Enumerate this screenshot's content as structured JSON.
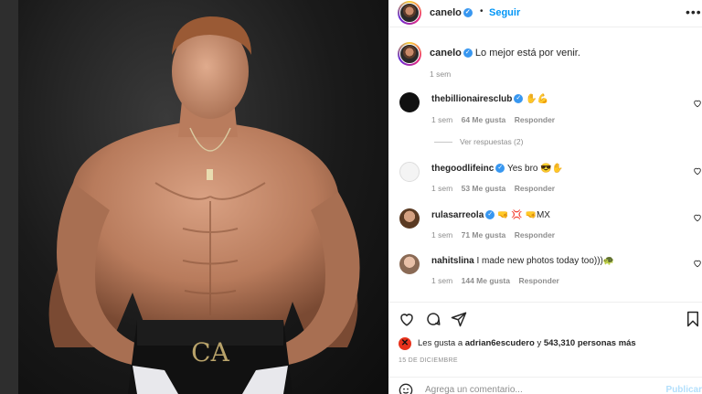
{
  "post": {
    "author": "canelo",
    "follow_label": "Seguir",
    "more_label": "•••"
  },
  "caption": {
    "username": "canelo",
    "text": "Lo mejor está por venir.",
    "time": "1 sem"
  },
  "comments": [
    {
      "username": "thebillionairesclub",
      "text": "✋💪",
      "time": "1 sem",
      "likes": "64 Me gusta",
      "reply": "Responder",
      "view_replies": "Ver respuestas (2)"
    },
    {
      "username": "thegoodlifeinc",
      "text": "Yes bro 😎✋",
      "time": "1 sem",
      "likes": "53 Me gusta",
      "reply": "Responder"
    },
    {
      "username": "rulasarreola",
      "text": "🤜 💢 🤜MX",
      "time": "1 sem",
      "likes": "71 Me gusta",
      "reply": "Responder"
    },
    {
      "username": "nahitslina",
      "text": "I made new photos today too)))🐢",
      "time": "1 sem",
      "likes": "144 Me gusta",
      "reply": "Responder"
    }
  ],
  "likes": {
    "prefix": "Les gusta a",
    "user": "adrian6escudero",
    "connector": "y",
    "count": "543,310 personas más"
  },
  "date": "15 DE DICIEMBRE",
  "comment_box": {
    "placeholder": "Agrega un comentario...",
    "post_label": "Publicar"
  },
  "colors": {
    "accent": "#0095f6",
    "text": "#262626",
    "muted": "#8e8e8e",
    "photo_bg": "#1a1a1a"
  }
}
